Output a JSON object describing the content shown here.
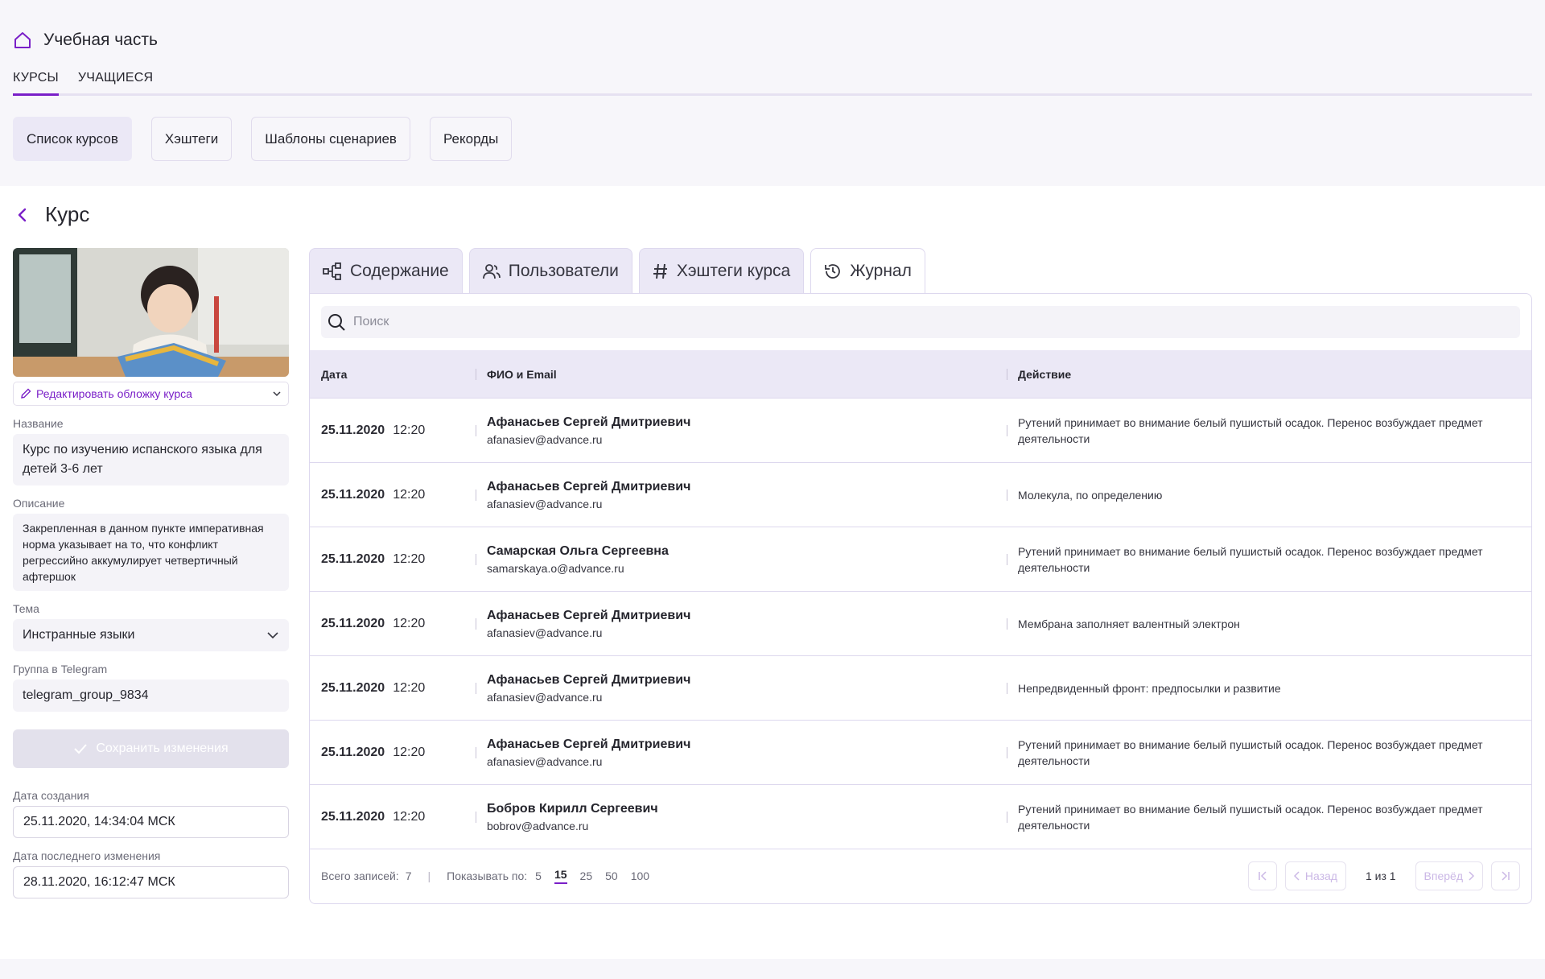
{
  "header": {
    "title": "Учебная часть",
    "main_tabs": [
      "КУРСЫ",
      "УЧАЩИЕСЯ"
    ],
    "sub_nav": [
      "Список курсов",
      "Хэштеги",
      "Шаблоны сценариев",
      "Рекорды"
    ]
  },
  "page": {
    "title": "Курс"
  },
  "course": {
    "edit_cover": "Редактировать обложку курса",
    "name_label": "Название",
    "name_value": "Курс по изучению испанского языка для детей 3-6 лет",
    "desc_label": "Описание",
    "desc_value": "Закрепленная в данном пункте императивная норма указывает на то, что конфликт регрессийно аккумулирует четвертичный афтершок",
    "topic_label": "Тема",
    "topic_value": "Инстранные языки",
    "telegram_label": "Группа в Telegram",
    "telegram_value": "telegram_group_9834",
    "save_label": "Сохранить изменения",
    "created_label": "Дата создания",
    "created_value": "25.11.2020, 14:34:04 МСК",
    "modified_label": "Дата последнего изменения",
    "modified_value": "28.11.2020, 16:12:47 МСК"
  },
  "tabs": [
    "Содержание",
    "Пользователи",
    "Хэштеги курса",
    "Журнал"
  ],
  "search": {
    "placeholder": "Поиск"
  },
  "table": {
    "columns": [
      "Дата",
      "ФИО и Email",
      "Действие"
    ],
    "rows": [
      {
        "date": "25.11.2020",
        "time": "12:20",
        "name": "Афанасьев Сергей Дмитриевич",
        "email": "afanasiev@advance.ru",
        "action": "Рутений принимает во внимание белый пушистый осадок. Перенос возбуждает предмет деятельности"
      },
      {
        "date": "25.11.2020",
        "time": "12:20",
        "name": "Афанасьев Сергей Дмитриевич",
        "email": "afanasiev@advance.ru",
        "action": "Молекула, по определению"
      },
      {
        "date": "25.11.2020",
        "time": "12:20",
        "name": "Самарская Ольга Сергеевна",
        "email": "samarskaya.o@advance.ru",
        "action": "Рутений принимает во внимание белый пушистый осадок. Перенос возбуждает предмет деятельности"
      },
      {
        "date": "25.11.2020",
        "time": "12:20",
        "name": "Афанасьев Сергей Дмитриевич",
        "email": "afanasiev@advance.ru",
        "action": "Мембрана заполняет валентный электрон"
      },
      {
        "date": "25.11.2020",
        "time": "12:20",
        "name": "Афанасьев Сергей Дмитриевич",
        "email": "afanasiev@advance.ru",
        "action": "Непредвиденный фронт: предпосылки и развитие"
      },
      {
        "date": "25.11.2020",
        "time": "12:20",
        "name": "Афанасьев Сергей Дмитриевич",
        "email": "afanasiev@advance.ru",
        "action": "Рутений принимает во внимание белый пушистый осадок. Перенос возбуждает предмет деятельности"
      },
      {
        "date": "25.11.2020",
        "time": "12:20",
        "name": "Бобров Кирилл Сергеевич",
        "email": "bobrov@advance.ru",
        "action": "Рутений принимает во внимание белый пушистый осадок. Перенос возбуждает предмет деятельности"
      }
    ]
  },
  "footer": {
    "total_label": "Всего записей:",
    "total_value": "7",
    "show_label": "Показывать по:",
    "page_sizes": [
      "5",
      "15",
      "25",
      "50",
      "100"
    ],
    "page_size_selected": "15",
    "prev_label": "Назад",
    "next_label": "Вперёд",
    "page_info": "1 из 1"
  },
  "colors": {
    "accent": "#7a1fc8",
    "header_bg": "#ebe8f6",
    "page_bg": "#f7f6fa"
  }
}
